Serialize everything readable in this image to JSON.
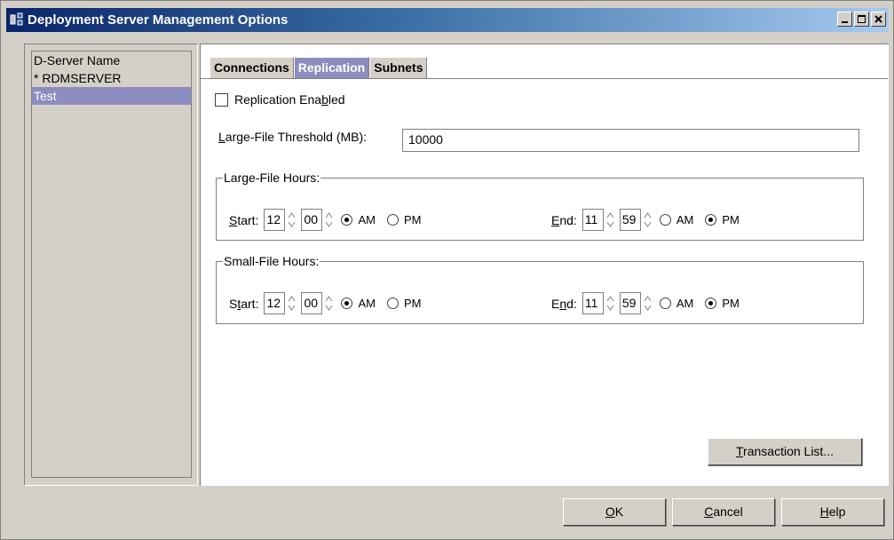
{
  "window": {
    "title": "Deployment Server Management Options",
    "buttons": {
      "minimize": "minimize-icon",
      "maximize": "maximize-icon",
      "close": "close-icon"
    }
  },
  "sidebar": {
    "items": [
      {
        "label": "D-Server Name",
        "selected": false
      },
      {
        "label": "* RDMSERVER",
        "selected": false
      },
      {
        "label": "Test",
        "selected": true
      }
    ]
  },
  "tabs": [
    {
      "label": "Connections",
      "active": false
    },
    {
      "label": "Replication",
      "active": true
    },
    {
      "label": "Subnets",
      "active": false
    }
  ],
  "replication": {
    "enabled_prefix": "Replication Ena",
    "enabled_mnemonic": "b",
    "enabled_suffix": "led",
    "enabled": false,
    "threshold_mnemonic": "L",
    "threshold_label_rest": "arge-File Threshold (MB):",
    "threshold_value": "10000"
  },
  "large_file_hours": {
    "legend": "Large-File Hours:",
    "start_mnemonic": "S",
    "start_rest": "tart:",
    "start_hour": "12",
    "start_minute": "00",
    "start_period": "AM",
    "end_mnemonic": "E",
    "end_rest": "nd:",
    "end_hour": "11",
    "end_minute": "59",
    "end_period": "PM",
    "am_label": "AM",
    "pm_label": "PM"
  },
  "small_file_hours": {
    "legend": "Small-File Hours:",
    "start_prefix": "S",
    "start_mnemonic": "t",
    "start_rest": "art:",
    "start_hour": "12",
    "start_minute": "00",
    "start_period": "AM",
    "end_prefix": "E",
    "end_mnemonic": "n",
    "end_rest": "d:",
    "end_hour": "11",
    "end_minute": "59",
    "end_period": "PM",
    "am_label": "AM",
    "pm_label": "PM"
  },
  "buttons": {
    "transaction_list_mnemonic": "T",
    "transaction_list_rest": "ransaction List...",
    "ok_mnemonic": "O",
    "ok_rest": "K",
    "cancel_mnemonic": "C",
    "cancel_rest": "ancel",
    "help_mnemonic": "H",
    "help_rest": "elp"
  }
}
